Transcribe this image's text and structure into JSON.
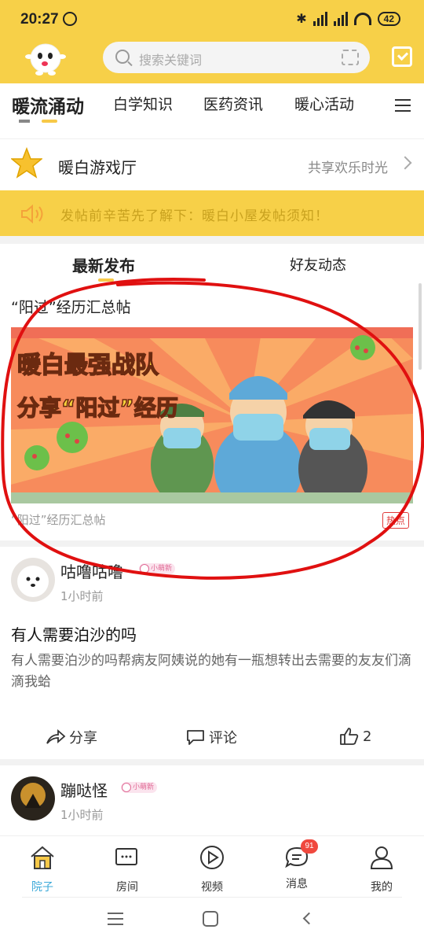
{
  "status_bar": {
    "time": "20:27",
    "battery": "42"
  },
  "header": {
    "search_placeholder": "搜索关键词"
  },
  "nav": {
    "tabs": [
      {
        "label": "暖流涌动",
        "active": true
      },
      {
        "label": "白学知识"
      },
      {
        "label": "医药资讯"
      },
      {
        "label": "暖心活动"
      }
    ]
  },
  "game_hall": {
    "title": "暖白游戏厅",
    "subtitle": "共享欢乐时光"
  },
  "notice": {
    "text": "发帖前辛苦先了解下：暖白小屋发帖须知！"
  },
  "feed_tabs": [
    {
      "label": "最新发布",
      "active": true
    },
    {
      "label": "好友动态"
    }
  ],
  "featured": {
    "title": "“阳过”经历汇总帖",
    "banner_line1": "暖白最强战队",
    "banner_line2": "分享“阳过”经历",
    "caption": "“阳过”经历汇总帖",
    "tag": "热点"
  },
  "posts": [
    {
      "user": "咕噜咕噜",
      "badge": "小萌新",
      "time": "1小时前",
      "title": "有人需要泊沙的吗",
      "body": "有人需要泊沙的吗帮病友阿姨说的她有一瓶想转出去需要的友友们滴滴我蛤",
      "share_label": "分享",
      "comment_label": "评论",
      "like_count": "2"
    },
    {
      "user": "蹦哒怪",
      "badge": "小萌新",
      "time": "1小时前"
    }
  ],
  "bottom_nav": [
    {
      "label": "院子",
      "active": true,
      "icon": "home-icon"
    },
    {
      "label": "房间",
      "icon": "chat-room-icon"
    },
    {
      "label": "视频",
      "icon": "play-icon"
    },
    {
      "label": "消息",
      "icon": "message-icon",
      "badge": "91"
    },
    {
      "label": "我的",
      "icon": "profile-icon"
    }
  ],
  "colors": {
    "brand_yellow": "#f7d048",
    "annotation_red": "#e01010",
    "active_blue": "#3aa8d8"
  }
}
